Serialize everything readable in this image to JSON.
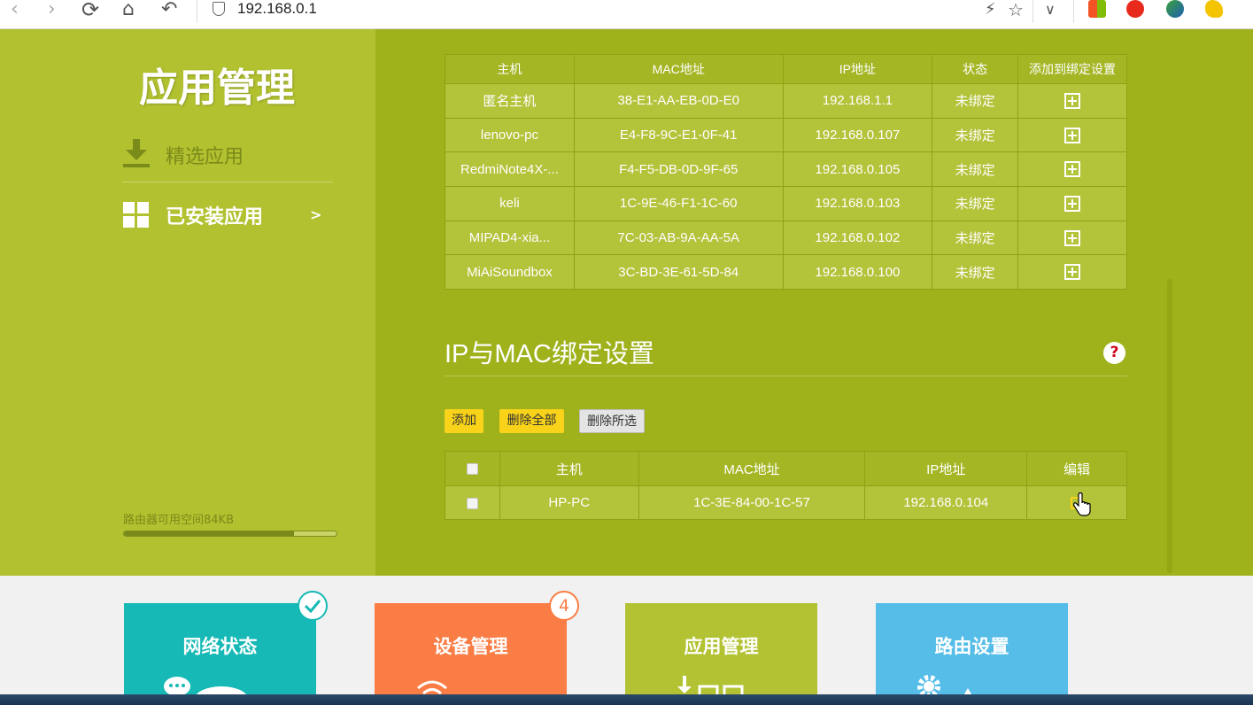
{
  "browser": {
    "address": "192.168.0.1"
  },
  "sidebar": {
    "title": "应用管理",
    "items": [
      {
        "label": "精选应用"
      },
      {
        "label": "已安装应用",
        "arrow": ">"
      }
    ],
    "storage_label": "路由器可用空间84KB",
    "storage_fraction": 0.8
  },
  "devices_table": {
    "headers": [
      "主机",
      "MAC地址",
      "IP地址",
      "状态",
      "添加到绑定设置"
    ],
    "rows": [
      {
        "host": "匿名主机",
        "mac": "38-E1-AA-EB-0D-E0",
        "ip": "192.168.1.1",
        "status": "未绑定"
      },
      {
        "host": "lenovo-pc",
        "mac": "E4-F8-9C-E1-0F-41",
        "ip": "192.168.0.107",
        "status": "未绑定"
      },
      {
        "host": "RedmiNote4X-...",
        "mac": "F4-F5-DB-0D-9F-65",
        "ip": "192.168.0.105",
        "status": "未绑定"
      },
      {
        "host": "keli",
        "mac": "1C-9E-46-F1-1C-60",
        "ip": "192.168.0.103",
        "status": "未绑定"
      },
      {
        "host": "MIPAD4-xia...",
        "mac": "7C-03-AB-9A-AA-5A",
        "ip": "192.168.0.102",
        "status": "未绑定"
      },
      {
        "host": "MiAiSoundbox",
        "mac": "3C-BD-3E-61-5D-84",
        "ip": "192.168.0.100",
        "status": "未绑定"
      }
    ]
  },
  "binding": {
    "title": "IP与MAC绑定设置",
    "help": "?",
    "buttons": {
      "add": "添加",
      "delete_all": "删除全部",
      "delete_selected": "删除所选"
    },
    "headers": [
      "主机",
      "MAC地址",
      "IP地址",
      "编辑"
    ],
    "rows": [
      {
        "host": "HP-PC",
        "mac": "1C-3E-84-00-1C-57",
        "ip": "192.168.0.104"
      }
    ]
  },
  "tiles": [
    {
      "label": "网络状态",
      "color": "#16b9b5"
    },
    {
      "label": "设备管理",
      "color": "#fa7d45",
      "badge": "4"
    },
    {
      "label": "应用管理",
      "color": "#b2c232"
    },
    {
      "label": "路由设置",
      "color": "#55bde8"
    }
  ],
  "colors": {
    "sidebar_bg": "#b1c12f",
    "content_bg": "#9fb21c",
    "button_yellow": "#f8d319"
  }
}
